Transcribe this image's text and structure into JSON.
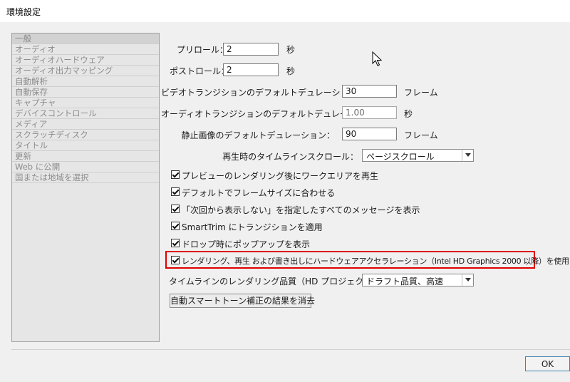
{
  "window": {
    "title": "環境設定"
  },
  "sidebar": {
    "items": [
      "一般",
      "オーディオ",
      "オーディオハードウェア",
      "オーディオ出力マッピング",
      "自動解析",
      "自動保存",
      "キャプチャ",
      "デバイスコントロール",
      "メディア",
      "スクラッチディスク",
      "タイトル",
      "更新",
      "Web に公開",
      "国または地域を選択"
    ],
    "selected_index": 0
  },
  "preroll": {
    "label": "プリロール：",
    "value": "2",
    "unit": "秒"
  },
  "postroll": {
    "label": "ポストロール：",
    "value": "2",
    "unit": "秒"
  },
  "video_transition": {
    "label": "ビデオトランジションのデフォルトデュレーション：",
    "value": "30",
    "unit": "フレーム"
  },
  "audio_transition": {
    "label": "オーディオトランジションのデフォルトデュレーション：",
    "value": "1.00",
    "unit": "秒"
  },
  "still_image": {
    "label": "静止画像のデフォルトデュレーション：",
    "value": "90",
    "unit": "フレーム"
  },
  "timeline_scroll": {
    "label": "再生時のタイムラインスクロール：",
    "value": "ページスクロール"
  },
  "checkboxes": [
    {
      "label": "プレビューのレンダリング後にワークエリアを再生",
      "checked": true
    },
    {
      "label": "デフォルトでフレームサイズに合わせる",
      "checked": true
    },
    {
      "label": "「次回から表示しない」を指定したすべてのメッセージを表示",
      "checked": true
    },
    {
      "label": "SmartTrim にトランジションを適用",
      "checked": true
    },
    {
      "label": "ドロップ時にポップアップを表示",
      "checked": true
    },
    {
      "label": "レンダリング、再生 および書き出しにハードウェアアクセラレーション（Intel HD Graphics 2000 以降）を使用",
      "checked": true
    }
  ],
  "render_quality": {
    "label": "タイムラインのレンダリング品質（HD プロジェクトで有効）：",
    "value": "ドラフト品質、高速"
  },
  "clear_button": {
    "label": "自動スマートトーン補正の結果を消去"
  },
  "ok_button": {
    "label": "OK"
  },
  "colors": {
    "highlight": "#e00000",
    "background": "#f0f0f0",
    "ok_border": "#3c7fb1"
  }
}
